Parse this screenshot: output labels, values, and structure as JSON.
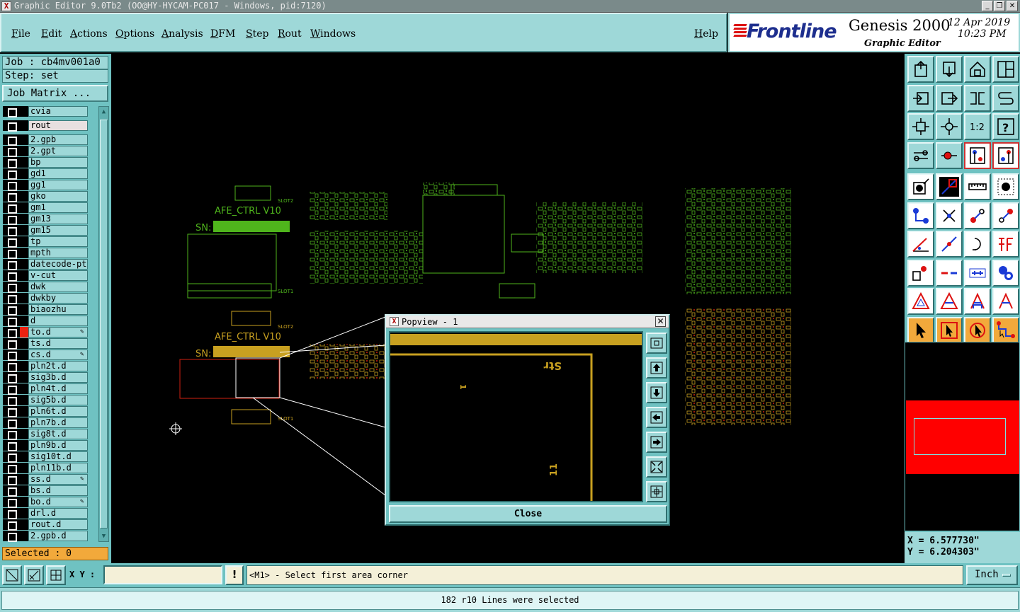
{
  "window": {
    "title": "Graphic Editor 9.0Tb2 (OO@HY-HYCAM-PC017 - Windows, pid:7120)",
    "minimize": "_",
    "maximize": "❐",
    "close": "✕"
  },
  "menu": {
    "file": "File",
    "edit": "Edit",
    "actions": "Actions",
    "options": "Options",
    "analysis": "Analysis",
    "dfm": "DFM",
    "step": "Step",
    "rout": "Rout",
    "windows": "Windows",
    "help": "Help"
  },
  "branding": {
    "logo": "Frontline",
    "product": "Genesis 2000",
    "subtitle": "Graphic Editor",
    "date": "12 Apr 2019",
    "time": "10:23 PM"
  },
  "job": {
    "job": "Job : cb4mv001a0",
    "step": "Step: set",
    "matrix_button": "Job Matrix ..."
  },
  "layers": [
    {
      "name": "cvia",
      "mark": ""
    },
    {
      "name": "rout",
      "mark": "",
      "selected": true
    },
    {
      "name": "2.gpb",
      "mark": ""
    },
    {
      "name": "2.gpt",
      "mark": ""
    },
    {
      "name": "bp",
      "mark": ""
    },
    {
      "name": "gd1",
      "mark": ""
    },
    {
      "name": "gg1",
      "mark": ""
    },
    {
      "name": "gko",
      "mark": ""
    },
    {
      "name": "gm1",
      "mark": ""
    },
    {
      "name": "gm13",
      "mark": ""
    },
    {
      "name": "gm15",
      "mark": ""
    },
    {
      "name": "tp",
      "mark": ""
    },
    {
      "name": "mpth",
      "mark": ""
    },
    {
      "name": "datecode-pt",
      "mark": ""
    },
    {
      "name": "v-cut",
      "mark": ""
    },
    {
      "name": "dwk",
      "mark": ""
    },
    {
      "name": "dwkby",
      "mark": ""
    },
    {
      "name": "biaozhu",
      "mark": ""
    },
    {
      "name": "d",
      "mark": ""
    },
    {
      "name": "to.d",
      "mark": "red",
      "edit": "✎"
    },
    {
      "name": "ts.d",
      "mark": ""
    },
    {
      "name": "cs.d",
      "mark": "",
      "edit": "✎"
    },
    {
      "name": "pln2t.d",
      "mark": ""
    },
    {
      "name": "sig3b.d",
      "mark": ""
    },
    {
      "name": "pln4t.d",
      "mark": ""
    },
    {
      "name": "sig5b.d",
      "mark": ""
    },
    {
      "name": "pln6t.d",
      "mark": ""
    },
    {
      "name": "pln7b.d",
      "mark": ""
    },
    {
      "name": "sig8t.d",
      "mark": ""
    },
    {
      "name": "pln9b.d",
      "mark": ""
    },
    {
      "name": "sig10t.d",
      "mark": ""
    },
    {
      "name": "pln11b.d",
      "mark": ""
    },
    {
      "name": "ss.d",
      "mark": "",
      "edit": "✎"
    },
    {
      "name": "bs.d",
      "mark": ""
    },
    {
      "name": "bo.d",
      "mark": "",
      "edit": "✎"
    },
    {
      "name": "drl.d",
      "mark": ""
    },
    {
      "name": "rout.d",
      "mark": ""
    },
    {
      "name": "2.gpb.d",
      "mark": ""
    }
  ],
  "selected_count": "Selected : 0",
  "board": {
    "label_top": "AFE_CTRL V10",
    "label_bottom": "AFE_CTRL V10",
    "sn_top": "SN:",
    "sn_bottom": "SN:",
    "slot_labels": [
      "SLOT2",
      "SLOT1",
      "SLOT2",
      "SLOT1"
    ],
    "colors": {
      "top_layer": "#4fb51c",
      "bottom_layer": "#c8a020",
      "highlight": "#d02010"
    }
  },
  "popview": {
    "title": "Popview - 1",
    "text_a": "Str",
    "text_b": "1",
    "text_c": "11",
    "close_label": "Close"
  },
  "coords": {
    "x": "X = 6.577730\"",
    "y": "Y = 6.204303\""
  },
  "command": {
    "xy_label": "X Y :",
    "xy_value": "",
    "prompt": "<M1> - Select first area corner",
    "units": "Inch"
  },
  "status": "182 r10 Lines were selected",
  "toolbar_icons": [
    "open-job-icon",
    "save-icon",
    "home-icon",
    "window-split-icon",
    "import-icon",
    "export-icon",
    "mirror-icon",
    "s-curve-icon",
    "fit-icon",
    "center-icon",
    "scale-1-2-icon",
    "help-icon",
    "measure-tool-icon",
    "netlist-icon",
    "layer-compare-icon",
    "layer-compare-red-icon",
    "feature-select-icon",
    "diagonal-line-icon",
    "ruler-icon",
    "pad-icon",
    "connect-icon",
    "cross-icon",
    "move-point-icon",
    "move-point-red-icon",
    "angle-icon",
    "line-edit-icon",
    "arc-icon",
    "split-icon",
    "snap-icon",
    "cut-line-icon",
    "fit-box-icon",
    "group-icon",
    "triangle-icon",
    "triangle-solid-icon",
    "a-frame-icon",
    "a-frame-red-icon",
    "pointer-icon",
    "pointer-box-icon",
    "pointer-target-icon",
    "route-icon"
  ]
}
